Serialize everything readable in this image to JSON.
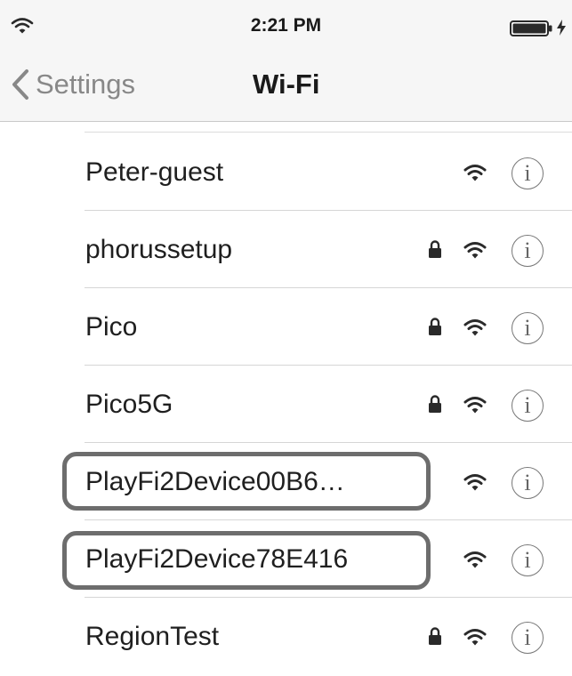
{
  "status_bar": {
    "time": "2:21 PM",
    "wifi_icon": "wifi-signal-icon",
    "battery_icon": "battery-icon",
    "charging_icon": "charging-bolt-icon"
  },
  "nav": {
    "back_label": "Settings",
    "back_icon": "chevron-left-icon",
    "title": "Wi-Fi"
  },
  "networks": [
    {
      "name": "Peter-guest",
      "locked": false,
      "highlighted": false
    },
    {
      "name": "phorussetup",
      "locked": true,
      "highlighted": false
    },
    {
      "name": "Pico",
      "locked": true,
      "highlighted": false
    },
    {
      "name": "Pico5G",
      "locked": true,
      "highlighted": false
    },
    {
      "name": "PlayFi2Device00B6…",
      "locked": false,
      "highlighted": true
    },
    {
      "name": "PlayFi2Device78E416",
      "locked": false,
      "highlighted": true
    },
    {
      "name": "RegionTest",
      "locked": true,
      "highlighted": false
    }
  ],
  "info_glyph": "i",
  "colors": {
    "bar_background": "#f6f6f6",
    "highlight_border": "#6d6d6d",
    "back_text": "#888888"
  }
}
